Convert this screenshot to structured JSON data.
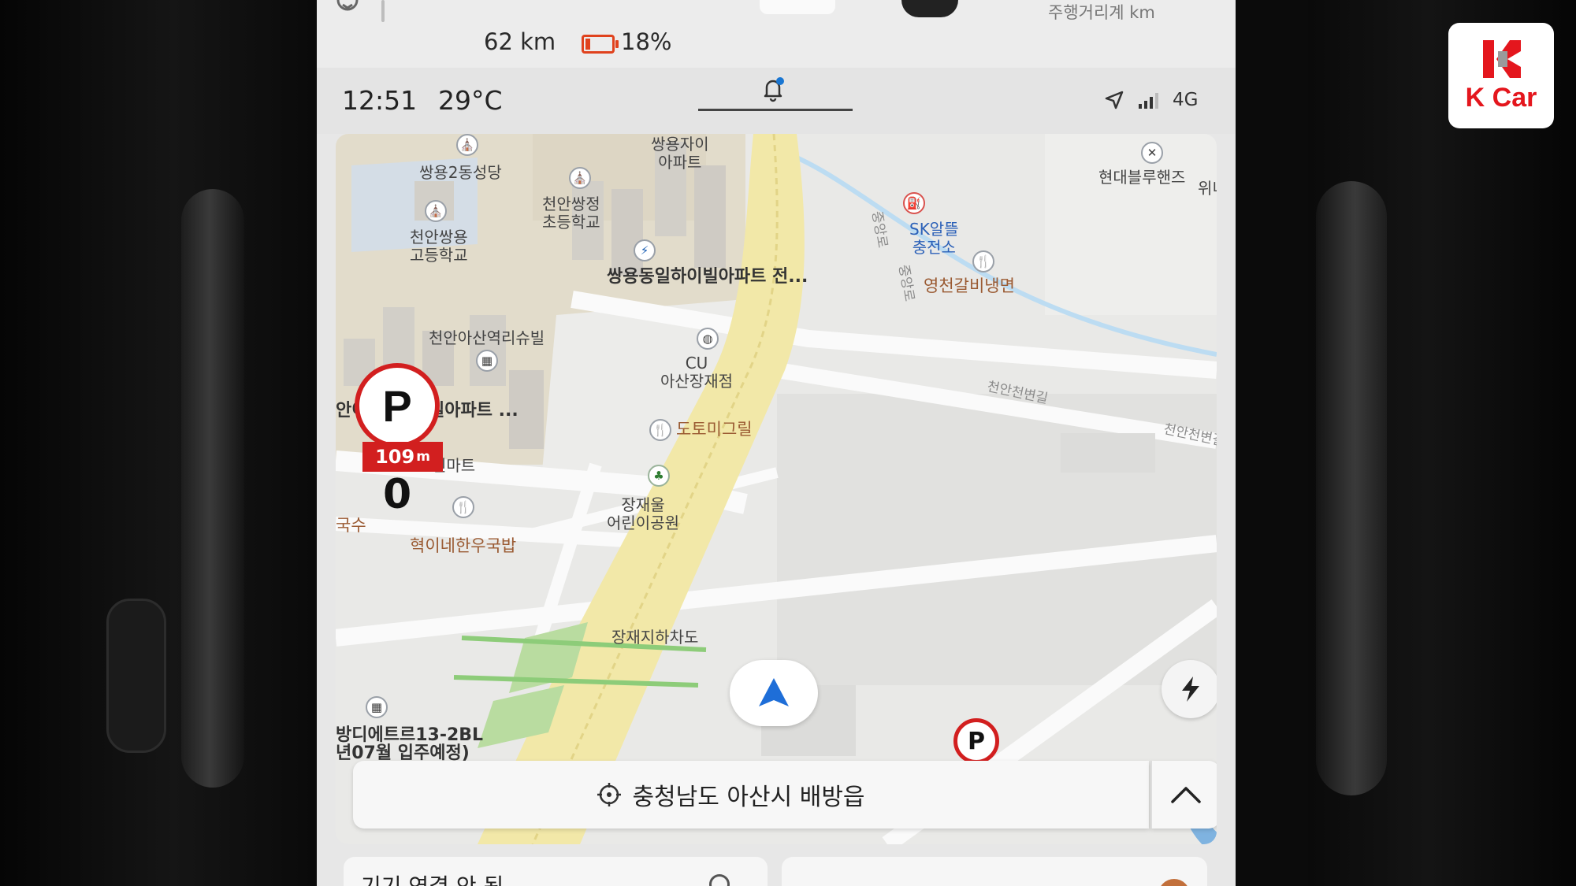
{
  "brand": {
    "name": "K Car",
    "color": "#e4161d"
  },
  "top_panel": {
    "odometer_label": "주행거리계 km",
    "range": "62 km",
    "battery_percent": "18%",
    "battery_level": 0.18,
    "battery_color": "#e0421d"
  },
  "status_bar": {
    "time": "12:51",
    "temperature": "29°C",
    "network": "4G",
    "icons": [
      "notification-bell-icon",
      "location-arrow-icon",
      "signal-bars-icon"
    ]
  },
  "map": {
    "labels": {
      "ssangyong2_church": "쌍용2동성당",
      "ssangyong_xi": "쌍용자이\n아파트",
      "cheonan_ssangyong_elem": "천안쌍정\n초등학교",
      "cheonan_ssangyong_high": "천안쌍용\n고등학교",
      "ssangyong_dongil": "쌍용동일하이빌아파트 전...",
      "sk_station": "SK알뜰\n충전소",
      "hyundai_bluehands": "현대블루핸즈",
      "yeongcheon": "영천갈비냉면",
      "cheonan_asan_suvill": "천안아산역리슈빌",
      "cu_store": "CU\n아산장재점",
      "dotomi": "도토미그릴",
      "apartment_left": "빌아파트 ...",
      "left_fragment": "안이",
      "mart": "인마트",
      "kalguksu": "국수",
      "hyeoine": "혁이네한우국밥",
      "jangjaeul_park": "장재울\n어린이공원",
      "jangjae_underpass": "장재지하차도",
      "cheonan_cheonbyeon_1": "천안천변길",
      "cheonan_cheonbyeon_2": "천안천변길",
      "jungangno_1": "중앙로",
      "jungangno_2": "중앙로",
      "didi_etre": "방디에트르13-2BL\n년07월 입주예정)",
      "wini": "위니"
    },
    "parking": {
      "label": "P",
      "distance": "109",
      "unit": "m"
    },
    "speed": "0",
    "parking_small_label": "P"
  },
  "address_bar": {
    "address": "충청남도 아산시 배방읍",
    "expand_icon": "chevron-up-icon"
  },
  "bottom_cards": {
    "left_text": "기기 연결 안 됨"
  }
}
